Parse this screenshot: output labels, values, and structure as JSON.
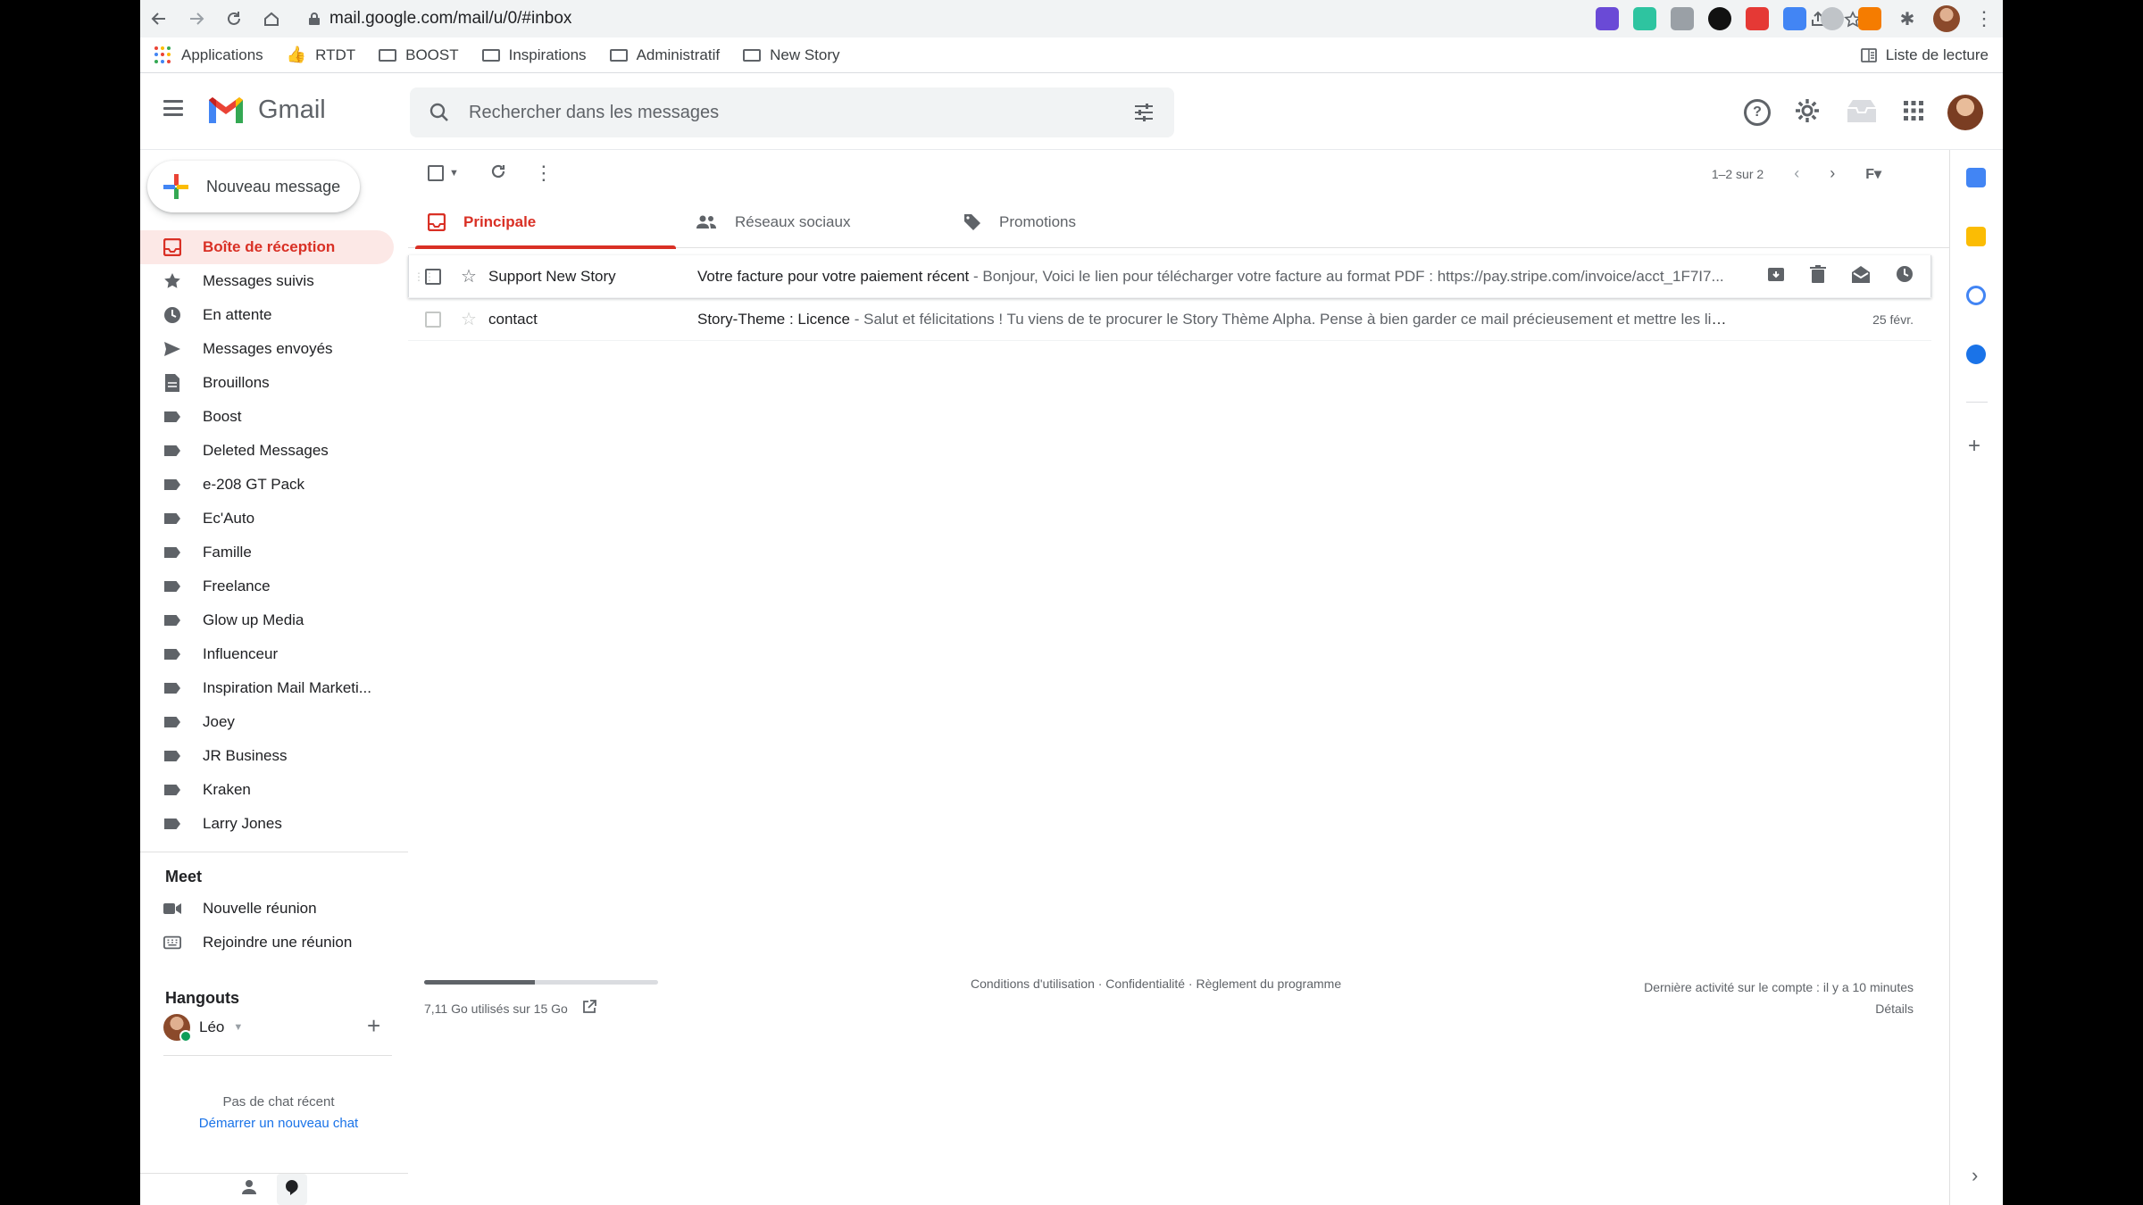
{
  "browser": {
    "url": "mail.google.com/mail/u/0/#inbox",
    "bookmarks": [
      {
        "label": "Applications",
        "icon": "apps-grid-icon"
      },
      {
        "label": "RTDT",
        "icon": "thumb-icon"
      },
      {
        "label": "BOOST",
        "icon": "folder-icon"
      },
      {
        "label": "Inspirations",
        "icon": "folder-icon"
      },
      {
        "label": "Administratif",
        "icon": "folder-icon"
      },
      {
        "label": "New Story",
        "icon": "folder-icon"
      }
    ],
    "reading_list": "Liste de lecture"
  },
  "header": {
    "app_name": "Gmail",
    "search_placeholder": "Rechercher dans les messages",
    "help_glyph": "?"
  },
  "sidebar": {
    "compose_label": "Nouveau message",
    "items": [
      {
        "label": "Boîte de réception",
        "icon": "inbox-icon",
        "active": true
      },
      {
        "label": "Messages suivis",
        "icon": "star-icon"
      },
      {
        "label": "En attente",
        "icon": "clock-icon"
      },
      {
        "label": "Messages envoyés",
        "icon": "send-icon"
      },
      {
        "label": "Brouillons",
        "icon": "draft-icon"
      },
      {
        "label": "Boost",
        "icon": "label-icon"
      },
      {
        "label": "Deleted Messages",
        "icon": "label-icon"
      },
      {
        "label": "e-208 GT Pack",
        "icon": "label-icon"
      },
      {
        "label": "Ec'Auto",
        "icon": "label-icon"
      },
      {
        "label": "Famille",
        "icon": "label-icon"
      },
      {
        "label": "Freelance",
        "icon": "label-icon"
      },
      {
        "label": "Glow up Media",
        "icon": "label-icon"
      },
      {
        "label": "Influenceur",
        "icon": "label-icon"
      },
      {
        "label": "Inspiration Mail Marketi...",
        "icon": "label-icon"
      },
      {
        "label": "Joey",
        "icon": "label-icon"
      },
      {
        "label": "JR Business",
        "icon": "label-icon"
      },
      {
        "label": "Kraken",
        "icon": "label-icon"
      },
      {
        "label": "Larry Jones",
        "icon": "label-icon"
      }
    ],
    "meet": {
      "title": "Meet",
      "new_meeting": "Nouvelle réunion",
      "join_meeting": "Rejoindre une réunion"
    },
    "hangouts": {
      "title": "Hangouts",
      "user": "Léo",
      "no_chat": "Pas de chat récent",
      "start_chat": "Démarrer un nouveau chat"
    }
  },
  "toolbar": {
    "pager": "1–2 sur 2"
  },
  "tabs": [
    {
      "label": "Principale",
      "icon": "inbox-icon",
      "active": true
    },
    {
      "label": "Réseaux sociaux",
      "icon": "people-icon"
    },
    {
      "label": "Promotions",
      "icon": "tag-icon"
    }
  ],
  "emails": [
    {
      "sender": "Support New Story",
      "subject": "Votre facture pour votre paiement récent",
      "snippet": " - Bonjour, Voici le lien pour télécharger votre facture au format PDF : https://pay.stripe.com/invoice/acct_1F7I7...",
      "date": ""
    },
    {
      "sender": "contact",
      "subject": "Story-Theme : Licence",
      "snippet": " - Salut et félicitations ! Tu viens de te procurer le Story Thème Alpha. Pense à bien garder ce mail précieusement et mettre les liens qu'il cont...",
      "date": "25 févr."
    }
  ],
  "footer": {
    "storage_text": "7,11 Go utilisés sur 15 Go",
    "storage_fraction": 0.474,
    "links": "Conditions d'utilisation · Confidentialité · Règlement du programme",
    "last_activity": "Dernière activité sur le compte : il y a 10 minutes",
    "details": "Détails"
  },
  "colors": {
    "accent_red": "#d93025",
    "active_bg": "#fce8e6",
    "link_blue": "#1a73e8"
  }
}
